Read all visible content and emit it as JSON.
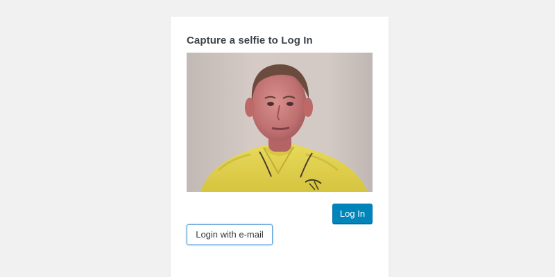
{
  "login": {
    "title": "Capture a selfie to Log In",
    "camera": {
      "content": "live-camera-selfie"
    },
    "login_button_label": "Log In",
    "email_login_label": "Login with e-mail"
  },
  "colors": {
    "page_background": "#f1f1f1",
    "card_background": "#ffffff",
    "primary_button": "#0085ba",
    "secondary_border": "#5b9dd9",
    "title_text": "#3c434a"
  }
}
